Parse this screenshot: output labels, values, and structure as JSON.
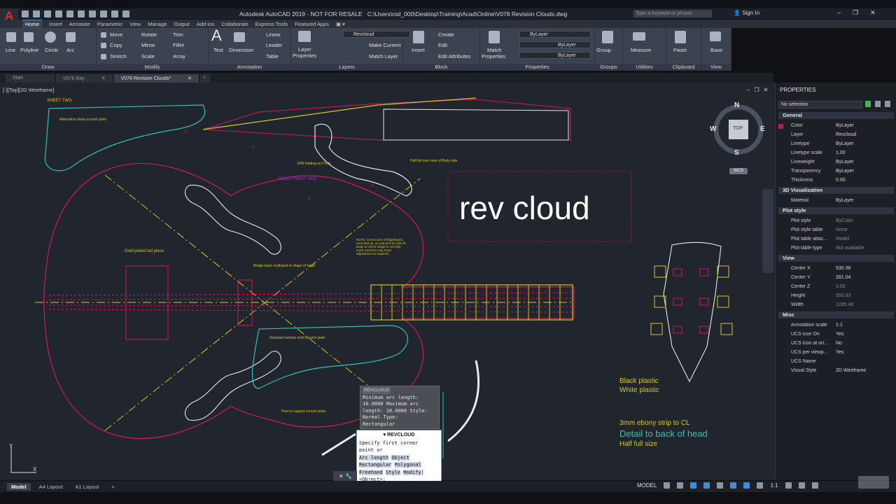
{
  "app": {
    "title": "Autodesk AutoCAD 2019 - NOT FOR RESALE",
    "file_path": "C:\\Users\\rod_000\\Desktop\\Training\\Acad\\Online\\V078 Revision Clouds.dwg",
    "search_placeholder": "Type a keyword or phrase",
    "sign_in": "Sign In",
    "logo": "A"
  },
  "ribbon_tabs": [
    "Home",
    "Insert",
    "Annotate",
    "Parametric",
    "View",
    "Manage",
    "Output",
    "Add-ins",
    "Collaborate",
    "Express Tools",
    "Featured Apps"
  ],
  "ribbon": {
    "draw": {
      "title": "Draw",
      "line": "Line",
      "polyline": "Polyline",
      "circle": "Circle",
      "arc": "Arc"
    },
    "modify": {
      "title": "Modify",
      "move": "Move",
      "rotate": "Rotate",
      "trim": "Trim",
      "copy": "Copy",
      "mirror": "Mirror",
      "fillet": "Fillet",
      "stretch": "Stretch",
      "scale": "Scale",
      "array": "Array"
    },
    "annotation": {
      "title": "Annotation",
      "text": "Text",
      "dimension": "Dimension",
      "linear": "Linear",
      "leader": "Leader",
      "table": "Table"
    },
    "layers": {
      "title": "Layers",
      "layer_properties_1": "Layer",
      "layer_properties_2": "Properties",
      "current_layer": "Revcloud",
      "make_current": "Make Current",
      "match_layer": "Match Layer"
    },
    "block": {
      "title": "Block",
      "insert": "Insert",
      "create": "Create",
      "edit": "Edit",
      "edit_attributes": "Edit Attributes"
    },
    "properties": {
      "title": "Properties",
      "match_1": "Match",
      "match_2": "Properties",
      "color": "ByLayer",
      "linetype": "ByLayer",
      "lineweight": "ByLayer"
    },
    "groups": {
      "title": "Groups",
      "group": "Group"
    },
    "utilities": {
      "title": "Utilities",
      "measure": "Measure"
    },
    "clipboard": {
      "title": "Clipboard",
      "paste": "Paste"
    },
    "view": {
      "title": "View",
      "base": "Base"
    }
  },
  "doc_tabs": [
    "Start",
    "V076 Ray",
    "V078 Revision Clouds*"
  ],
  "viewport": {
    "label": "[-][Top][2D Wireframe]",
    "overlay_text": "rev cloud",
    "viewcube": {
      "top": "TOP",
      "n": "N",
      "s": "S",
      "e": "E",
      "w": "W",
      "wcs": "WCS"
    },
    "ucs_x": "X",
    "ucs_y": "Y"
  },
  "drawing_text": {
    "sheet_two": "SHEET TWO",
    "alt_scratch": "Alternative sharp scratch plate",
    "label_d": "D",
    "label_c": "C",
    "label_a": "A",
    "label_b": "B",
    "binding": "B/W binding on f hole",
    "body_side": "Half full size view of Body side",
    "purple": "SOLID FRONT SIDE",
    "tail_piece": "Gold plated tail piece",
    "bridge": "Bridge base scalloped to shape of head",
    "note": "NOTE: Check size of fingerboard once laid up, as required for frets fit. Body to check shape in 1/1 fully, some sections may need adjustment as required.",
    "scratch_plate": "Standard tortoise shell scratch plate",
    "post": "Post to support scratch plate",
    "black_plastic": "Black plastic",
    "white_plastic": "White plastic",
    "ebony": "3mm ebony strip to CL",
    "detail": "Detail to back of head",
    "half": "Half full size"
  },
  "tooltip": {
    "header": "REVCLOUD",
    "lines": [
      "Minimum arc length:",
      "10.0000  Maximum arc",
      "length: 10.0000  Style:",
      "Normal  Type:",
      "Rectangular"
    ]
  },
  "command": {
    "header": "REVCLOUD",
    "prompt_1": "Specify first corner",
    "prompt_2": "point or",
    "options": [
      "Arc length",
      "Object",
      "Rectangular",
      "Polygonal",
      "Freehand",
      "Style",
      "Modify"
    ],
    "default": "<Object>:"
  },
  "properties_palette": {
    "title": "PROPERTIES",
    "selection": "No selection",
    "sections": [
      {
        "name": "General",
        "rows": [
          [
            "Color",
            "ByLayer"
          ],
          [
            "Layer",
            "Revcloud"
          ],
          [
            "Linetype",
            "ByLayer"
          ],
          [
            "Linetype scale",
            "1.00"
          ],
          [
            "Lineweight",
            "ByLayer"
          ],
          [
            "Transparency",
            "ByLayer"
          ],
          [
            "Thickness",
            "0.00"
          ]
        ]
      },
      {
        "name": "3D Visualization",
        "rows": [
          [
            "Material",
            "ByLayer"
          ]
        ]
      },
      {
        "name": "Plot style",
        "rows": [
          [
            "Plot style",
            "ByColor"
          ],
          [
            "Plot style table",
            "None"
          ],
          [
            "Plot table attac...",
            "Model"
          ],
          [
            "Plot table type",
            "Not available"
          ]
        ]
      },
      {
        "name": "View",
        "rows": [
          [
            "Center X",
            "530.36"
          ],
          [
            "Center Y",
            "281.04"
          ],
          [
            "Center Z",
            "0.00"
          ],
          [
            "Height",
            "593.03"
          ],
          [
            "Width",
            "1285.40"
          ]
        ]
      },
      {
        "name": "Misc",
        "rows": [
          [
            "Annotation scale",
            "1:1"
          ],
          [
            "UCS icon On",
            "Yes"
          ],
          [
            "UCS icon at ori...",
            "No"
          ],
          [
            "UCS per viewp...",
            "Yes"
          ],
          [
            "UCS Name",
            ""
          ],
          [
            "Visual Style",
            "2D Wireframe"
          ]
        ]
      }
    ]
  },
  "layout_tabs": [
    "Model",
    "A4 Layout",
    "A1 Layout"
  ],
  "status": {
    "model": "MODEL",
    "scale": "1:1"
  },
  "colors": {
    "accent": "#3b8fd9",
    "layer_color": "#c2185b",
    "viewport_bg": "#21252d",
    "revcloud": "#d11b52"
  }
}
